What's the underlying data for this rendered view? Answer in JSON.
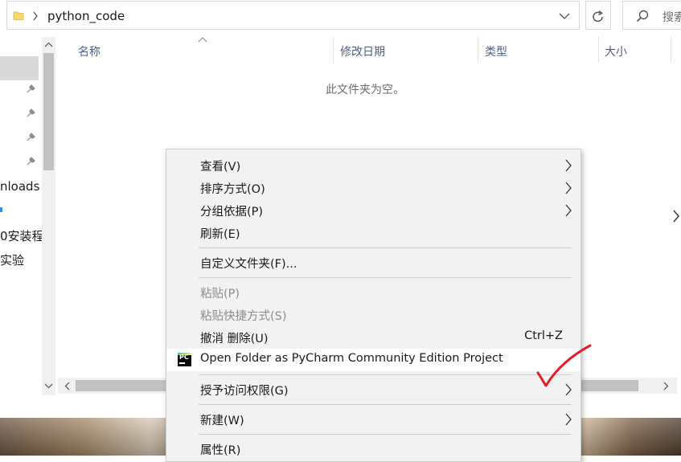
{
  "address_bar": {
    "path": "python_code"
  },
  "search": {
    "placeholder": "搜索"
  },
  "nav": {
    "items": [
      {
        "label": "nloads"
      },
      {
        "label": "0安装程"
      },
      {
        "label": "实验"
      }
    ]
  },
  "columns": {
    "name": "名称",
    "modified": "修改日期",
    "type": "类型",
    "size": "大小"
  },
  "empty_message": "此文件夹为空。",
  "context_menu": {
    "view": "查看(V)",
    "sort_by": "排序方式(O)",
    "group_by": "分组依据(P)",
    "refresh": "刷新(E)",
    "customize_folder": "自定义文件夹(F)...",
    "paste": "粘贴(P)",
    "paste_shortcut": "粘贴快捷方式(S)",
    "undo_delete": "撤消 删除(U)",
    "undo_shortcut": "Ctrl+Z",
    "pycharm_open": "Open Folder as PyCharm Community Edition Project",
    "grant_access": "授予访问权限(G)",
    "new": "新建(W)",
    "properties": "属性(R)"
  },
  "colors": {
    "accent_check": "#e0202a",
    "header_text": "#4d6185"
  },
  "icons": [
    "folder-icon",
    "chevron-right-icon",
    "chevron-down-icon",
    "refresh-icon",
    "search-icon",
    "pin-icon",
    "sort-up-icon",
    "pycharm-icon",
    "checkmark-icon"
  ]
}
